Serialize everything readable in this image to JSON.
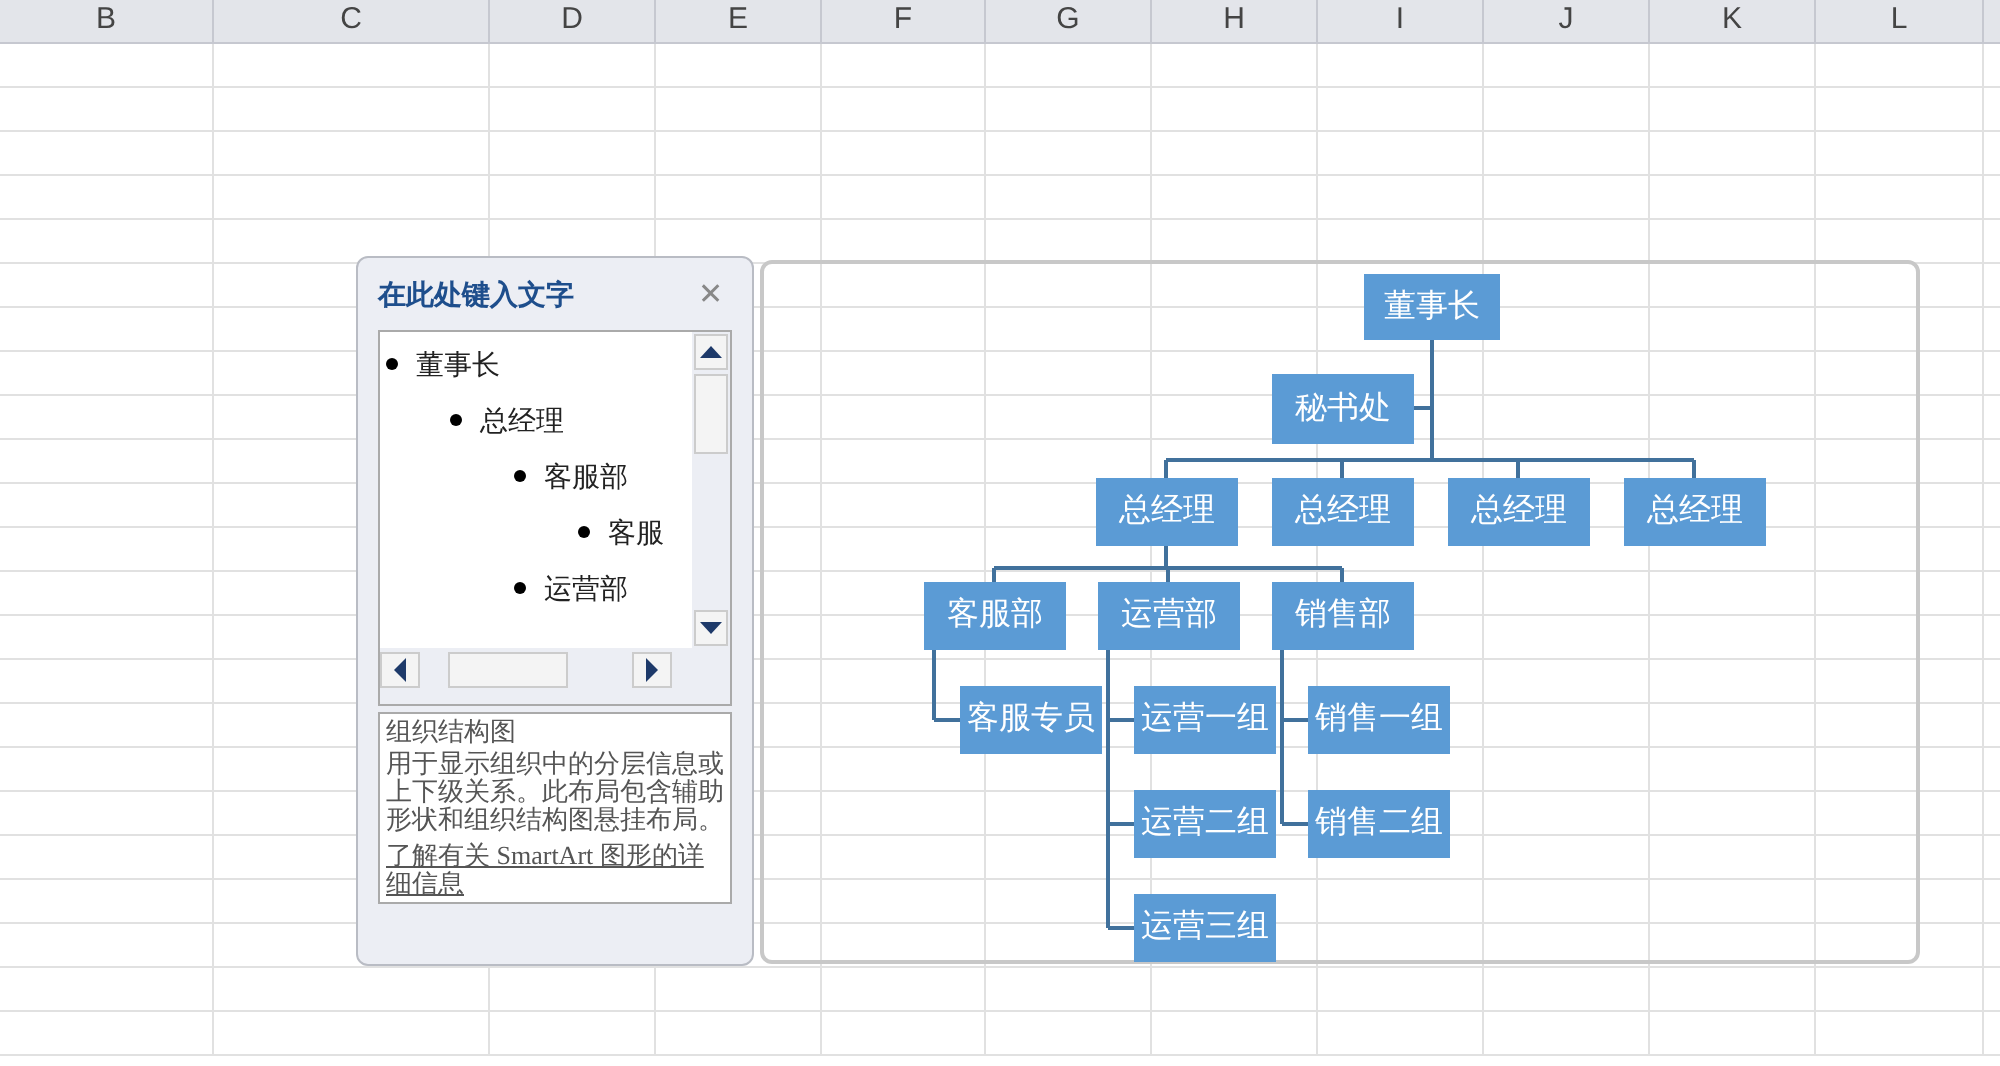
{
  "columns": [
    "B",
    "C",
    "D",
    "E",
    "F",
    "G",
    "H",
    "I",
    "J",
    "K",
    "L"
  ],
  "text_pane": {
    "title": "在此处键入文字",
    "close": "✕",
    "items": [
      {
        "text": "董事长",
        "children": [
          {
            "text": "总经理",
            "children": [
              {
                "text": "客服部",
                "children": [
                  {
                    "text": "客服"
                  }
                ]
              },
              {
                "text": "运营部"
              }
            ]
          }
        ]
      }
    ],
    "description": {
      "title": "组织结构图",
      "body": "用于显示组织中的分层信息或上下级关系。此布局包含辅助形状和组织结构图悬挂布局。",
      "link": "了解有关 SmartArt 图形的详细信息"
    }
  },
  "org_chart": {
    "root": "董事长",
    "assistant": "秘书处",
    "managers": [
      {
        "text": "总经理",
        "children": [
          {
            "text": "客服部",
            "children": [
              {
                "text": "客服专员"
              }
            ]
          },
          {
            "text": "运营部",
            "children": [
              {
                "text": "运营一组"
              },
              {
                "text": "运营二组"
              },
              {
                "text": "运营三组"
              }
            ]
          },
          {
            "text": "销售部",
            "children": [
              {
                "text": "销售一组"
              },
              {
                "text": "销售二组"
              }
            ]
          }
        ]
      },
      {
        "text": "总经理"
      },
      {
        "text": "总经理"
      },
      {
        "text": "总经理"
      }
    ]
  }
}
